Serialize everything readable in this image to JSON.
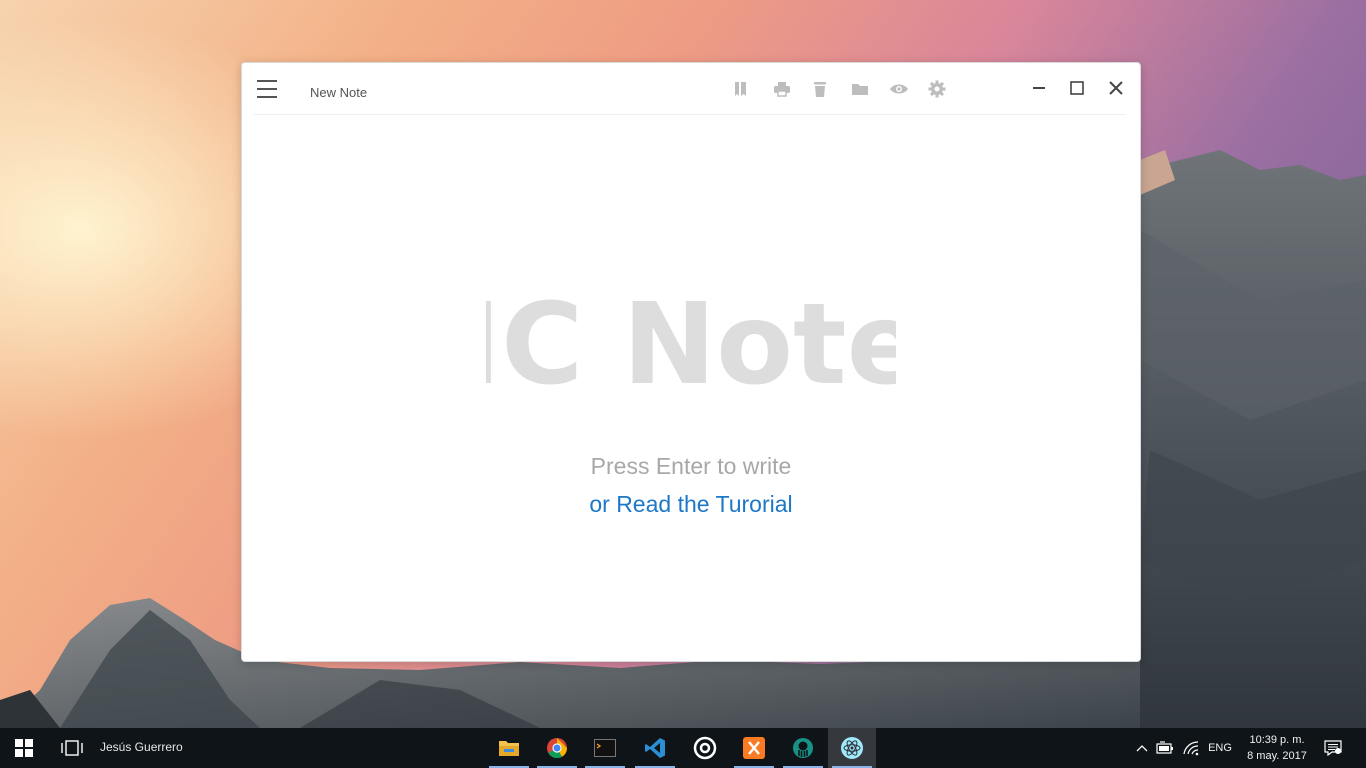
{
  "window": {
    "note_title": "New Note",
    "logo_text": "IC Note",
    "prompt": "Press Enter to write",
    "tutorial_link": "or Read the Turorial"
  },
  "toolbar": {
    "icons": [
      "bookmark-icon",
      "print-icon",
      "trash-icon",
      "folder-icon",
      "eye-icon",
      "gear-icon"
    ]
  },
  "window_controls": [
    "minimize-icon",
    "maximize-icon",
    "close-icon"
  ],
  "taskbar": {
    "user": "Jesús Guerrero",
    "apps": [
      "file-explorer-icon",
      "chrome-icon",
      "terminal-icon",
      "visual-studio-code-icon",
      "media-app-icon",
      "xampp-icon",
      "gitkraken-icon",
      "electron-icon"
    ],
    "language": "ENG",
    "time": "10:39 p. m.",
    "date": "8 may. 2017"
  },
  "colors": {
    "accent_link": "#1e78c8",
    "logo": "#dddddd",
    "prompt": "#a8a8a8"
  }
}
